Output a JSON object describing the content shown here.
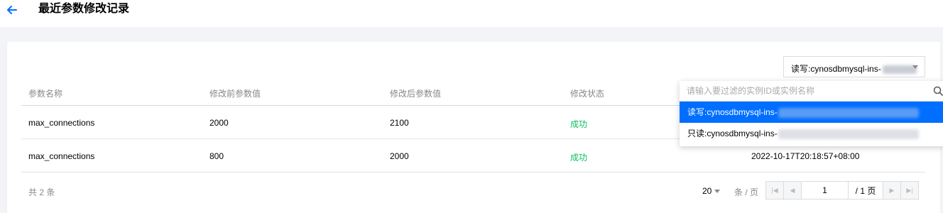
{
  "header": {
    "title": "最近参数修改记录"
  },
  "filter": {
    "selected_label": "读写:cynosdbmysql-ins-"
  },
  "table": {
    "columns": [
      "参数名称",
      "修改前参数值",
      "修改后参数值",
      "修改状态"
    ],
    "rows": [
      {
        "name": "max_connections",
        "before": "2000",
        "after": "2100",
        "status": "成功",
        "time": ""
      },
      {
        "name": "max_connections",
        "before": "800",
        "after": "2000",
        "status": "成功",
        "time": "2022-10-17T20:18:57+08:00"
      }
    ]
  },
  "pagination": {
    "total": "共 2 条",
    "page_size": "20",
    "per_page_label": "条 / 页",
    "current_page": "1",
    "total_pages": "/ 1 页"
  },
  "dropdown": {
    "search_placeholder": "请输入要过滤的实例ID或实例名称",
    "options": [
      {
        "label": "读写:cynosdbmysql-ins-"
      },
      {
        "label": "只读:cynosdbmysql-ins-"
      }
    ]
  },
  "colors": {
    "accent": "#006eff",
    "success": "#0abf5b"
  }
}
